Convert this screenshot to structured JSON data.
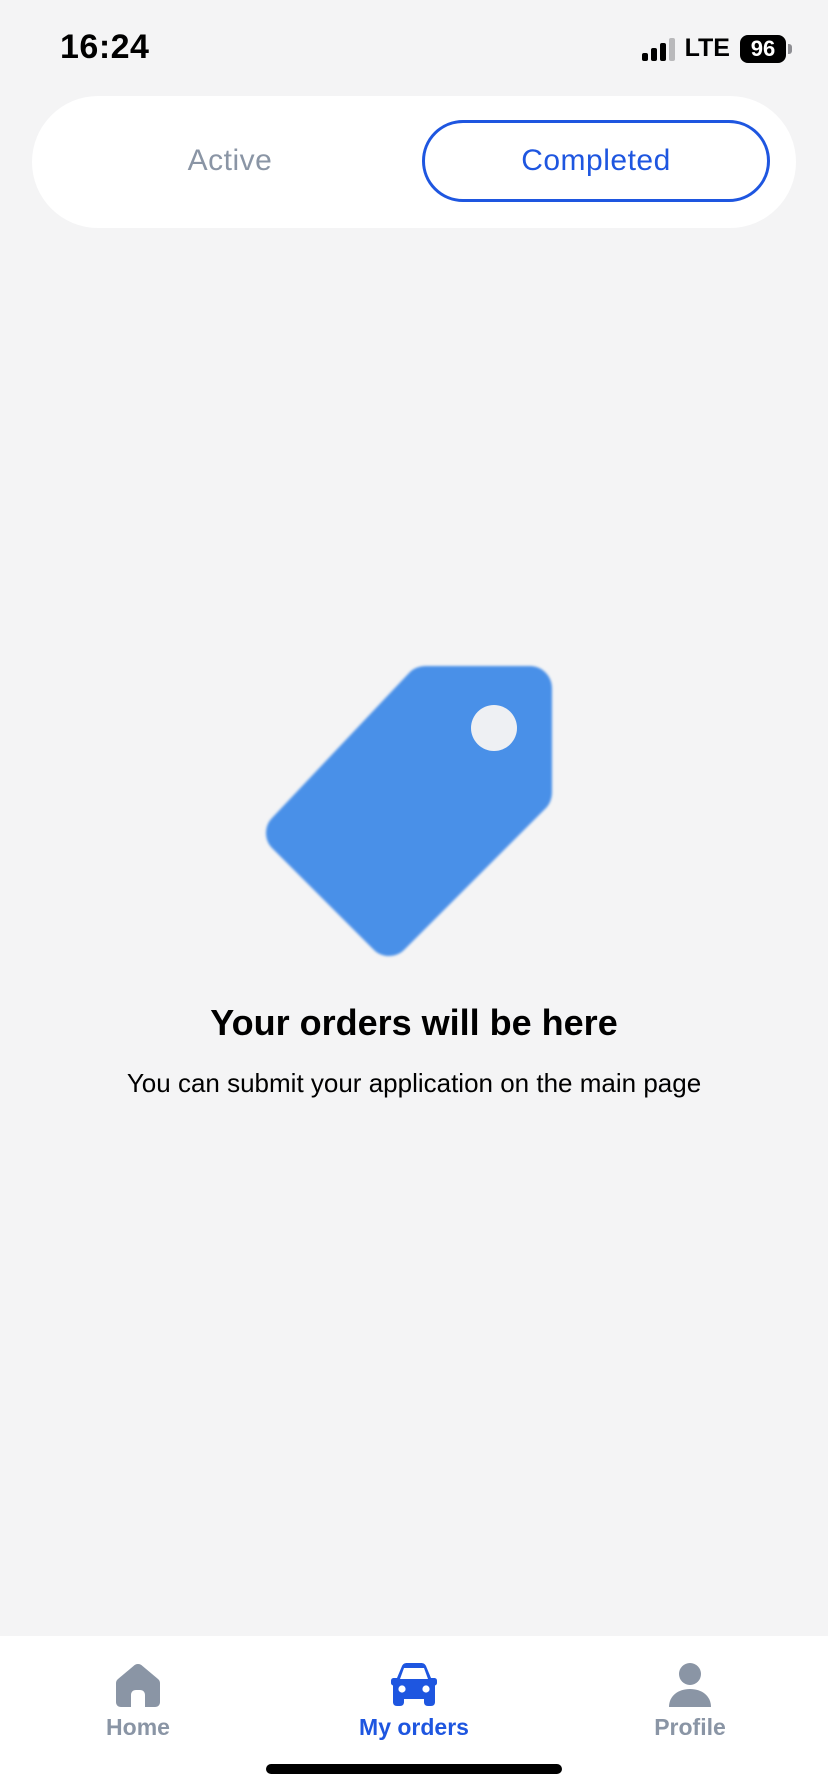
{
  "status_bar": {
    "time": "16:24",
    "network": "LTE",
    "battery": "96"
  },
  "tabs": {
    "items": [
      {
        "label": "Active",
        "selected": false
      },
      {
        "label": "Completed",
        "selected": true
      }
    ]
  },
  "empty_state": {
    "icon": "price-tag-icon",
    "title": "Your orders will be here",
    "subtitle": "You can submit your application on the main page"
  },
  "bottom_nav": {
    "items": [
      {
        "label": "Home",
        "icon": "home-icon",
        "active": false
      },
      {
        "label": "My orders",
        "icon": "car-icon",
        "active": true
      },
      {
        "label": "Profile",
        "icon": "person-icon",
        "active": false
      }
    ]
  },
  "colors": {
    "accent": "#1e56e0",
    "tag": "#4a90e8",
    "inactive": "#8a95a5",
    "background": "#f4f4f5"
  }
}
